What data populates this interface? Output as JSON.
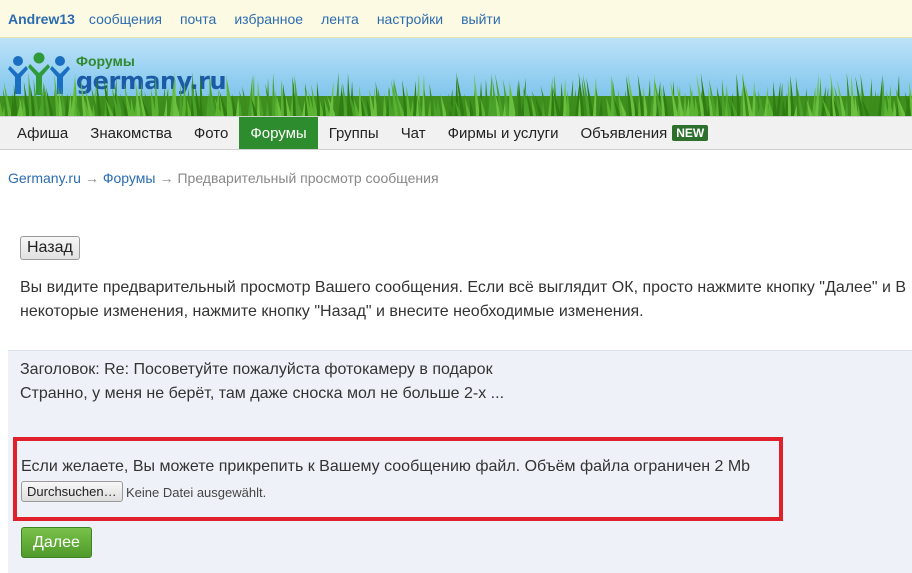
{
  "topbar": {
    "username": "Andrew13",
    "links": [
      "сообщения",
      "почта",
      "избранное",
      "лента",
      "настройки",
      "выйти"
    ]
  },
  "logo": {
    "line1": "Форумы",
    "line2": "germany.ru"
  },
  "nav": {
    "items": [
      "Афиша",
      "Знакомства",
      "Фото",
      "Форумы",
      "Группы",
      "Чат",
      "Фирмы и услуги",
      "Объявления"
    ],
    "active": "Форумы",
    "new_badge": "NEW"
  },
  "breadcrumb": {
    "home": "Germany.ru",
    "forums": "Форумы",
    "current": "Предварительный просмотр сообщения",
    "separator": "→"
  },
  "back_button": "Назад",
  "intro": {
    "line1": "Вы видите предварительный просмотр Вашего сообщения. Если всё выглядит ОК, просто нажмите кнопку \"Далее\" и В",
    "line2": "некоторые изменения, нажмите кнопку \"Назад\" и внесите необходимые изменения."
  },
  "preview": {
    "subject": "Заголовок: Re: Посоветуйте пожалуйста фотокамеру в подарок",
    "body": "Странно, у меня не берёт, там даже сноска мол не больше 2-х ..."
  },
  "attachment": {
    "note": "Если желаете, Вы можете прикрепить к Вашему сообщению файл. Объём файла ограничен 2 Mb",
    "browse_button": "Durchsuchen…",
    "status": "Keine Datei ausgewählt."
  },
  "next_button": "Далее",
  "colors": {
    "link": "#2b6cb0",
    "nav_active": "#2d8c2d",
    "highlight_border": "#e0202a",
    "next_button": "#5aa632"
  }
}
